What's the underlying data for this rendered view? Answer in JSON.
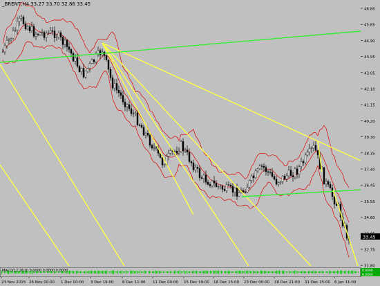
{
  "window": {
    "symbol": "_BRENT,H4",
    "ohlc": "33.27 33.70 32.86 33.45"
  },
  "oscillator": {
    "label": "MACD(12,26,9) 0.0000 0.0000 0.0000"
  },
  "price_axis": {
    "ticks": [
      "46.80",
      "45.85",
      "44.90",
      "43.95",
      "43.05",
      "42.10",
      "41.15",
      "40.20",
      "39.30",
      "38.35",
      "37.40",
      "36.45",
      "35.55",
      "34.60",
      "33.65",
      "32.75",
      "31.80"
    ],
    "current_price": "33.45",
    "osc_ticks": [
      "0.0000",
      "0.0000"
    ]
  },
  "time_axis": {
    "labels": [
      "23 Nov 2015",
      "26 Nov 00:00",
      "1 Dec 00:00",
      "3 Dec 19:00",
      "8 Dec 11:00",
      "11 Dec 00:00",
      "15 Dec 19:00",
      "18 Dec 15:00",
      "23 Dec 00:00",
      "28 Dec 21:00",
      "31 Dec 15:00",
      "6 Jan 11:00"
    ]
  },
  "colors": {
    "background": "#c0c0c0",
    "bull_candle": "#ffffff",
    "bear_candle": "#000000",
    "wick": "#000000",
    "bollinger": "#dd0000",
    "trendline_yellow": "#ffff44",
    "trendline_green": "#33ee33",
    "price_marker": "#000000",
    "osc_bar": "#00cc00"
  }
}
